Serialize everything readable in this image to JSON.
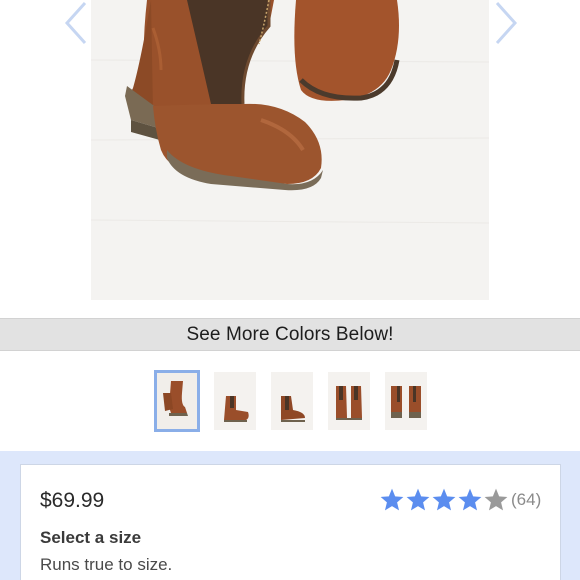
{
  "banner": {
    "text": "See More Colors Below!"
  },
  "gallery": {
    "images": [
      "boot-side-view",
      "boot-side-view-2",
      "boot-side-view-3",
      "boot-pair-front",
      "boot-pair-back"
    ],
    "selected_index": 0
  },
  "product": {
    "price": "$69.99",
    "rating": {
      "value": 4,
      "max": 5,
      "count": "(64)",
      "filled_color": "#5b8def",
      "empty_color": "#9a9a9a"
    },
    "size_heading": "Select a size",
    "size_note": "Runs true to size."
  },
  "colors": {
    "accent": "#8aaee8",
    "boot_leather": "#9a4e2a",
    "panel_bg": "#dde7fb"
  }
}
